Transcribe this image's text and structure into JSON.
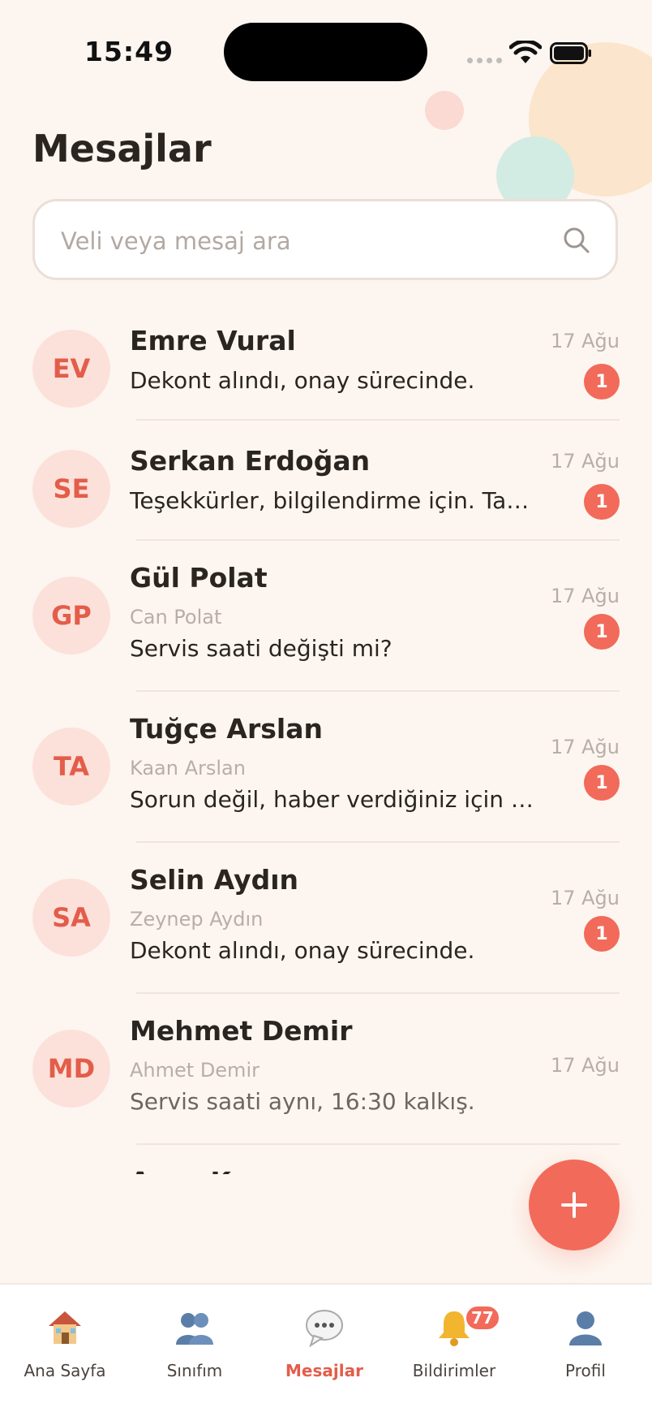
{
  "status_bar": {
    "time": "15:49"
  },
  "header": {
    "title": "Mesajlar"
  },
  "search": {
    "placeholder": "Veli veya mesaj ara"
  },
  "conversations": [
    {
      "initials": "EV",
      "name": "Emre Vural",
      "student": "",
      "message": "Dekont alındı, onay sürecinde.",
      "date": "17 Ağu",
      "unread": "1"
    },
    {
      "initials": "SE",
      "name": "Serkan Erdoğan",
      "student": "",
      "message": "Teşekkürler, bilgilendirme için. Takip edeceğim.",
      "date": "17 Ağu",
      "unread": "1"
    },
    {
      "initials": "GP",
      "name": "Gül Polat",
      "student": "Can Polat",
      "message": "Servis saati değişti mi?",
      "date": "17 Ağu",
      "unread": "1"
    },
    {
      "initials": "TA",
      "name": "Tuğçe Arslan",
      "student": "Kaan Arslan",
      "message": "Sorun değil, haber verdiğiniz için teşekkürler.",
      "date": "17 Ağu",
      "unread": "1"
    },
    {
      "initials": "SA",
      "name": "Selin Aydın",
      "student": "Zeynep Aydın",
      "message": "Dekont alındı, onay sürecinde.",
      "date": "17 Ağu",
      "unread": "1"
    },
    {
      "initials": "MD",
      "name": "Mehmet Demir",
      "student": "Ahmet Demir",
      "message": "Servis saati aynı, 16:30 kalkış.",
      "date": "17 Ağu",
      "unread": ""
    }
  ],
  "partial_row": {
    "name": "Ayşe K"
  },
  "tabbar": {
    "items": [
      {
        "label": "Ana Sayfa",
        "icon": "house-icon"
      },
      {
        "label": "Sınıfım",
        "icon": "people-icon"
      },
      {
        "label": "Mesajlar",
        "icon": "speech-bubble-icon"
      },
      {
        "label": "Bildirimler",
        "icon": "bell-icon",
        "badge": "77"
      },
      {
        "label": "Profil",
        "icon": "person-icon"
      }
    ],
    "active": "Mesajlar"
  },
  "colors": {
    "accent": "#F26A5A",
    "background": "#FDF6F0",
    "avatar_bg": "#FCE1DA",
    "avatar_text": "#E35D4A"
  }
}
